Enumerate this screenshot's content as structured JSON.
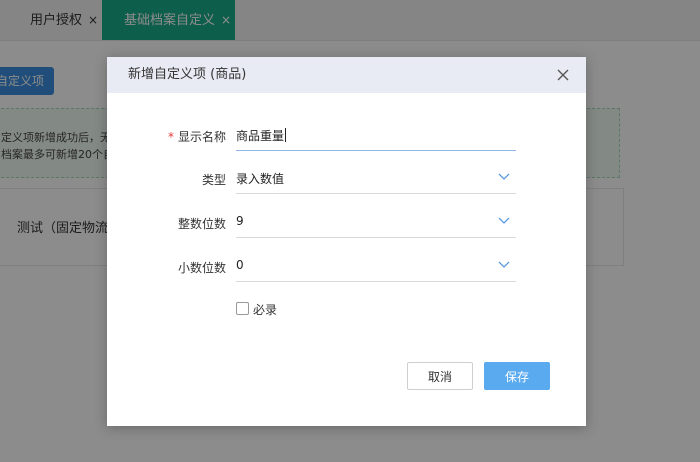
{
  "tabs": [
    {
      "label": "用户授权",
      "close": "×"
    },
    {
      "label": "基础档案自定义",
      "close": "×"
    }
  ],
  "background": {
    "button_label": "自定义项",
    "notice_lines": [
      "定义项新增成功后，无",
      "档案最多可新增20个自"
    ],
    "card_text": "测试（固定物流"
  },
  "modal": {
    "title": "新增自定义项 (商品)",
    "fields": [
      {
        "label": "显示名称",
        "required": true,
        "value": "商品重量",
        "type": "text"
      },
      {
        "label": "类型",
        "required": false,
        "value": "录入数值",
        "type": "select"
      },
      {
        "label": "整数位数",
        "required": false,
        "value": "9",
        "type": "select"
      },
      {
        "label": "小数位数",
        "required": false,
        "value": "0",
        "type": "select"
      }
    ],
    "required_marker": "*",
    "checkbox_label": "必录",
    "checkbox_checked": false,
    "cancel_label": "取消",
    "save_label": "保存"
  },
  "colors": {
    "accent_tab": "#1aab8a",
    "primary_button": "#5aaaf0",
    "header_bg": "#e8ebf3",
    "required": "#e23c3c"
  }
}
